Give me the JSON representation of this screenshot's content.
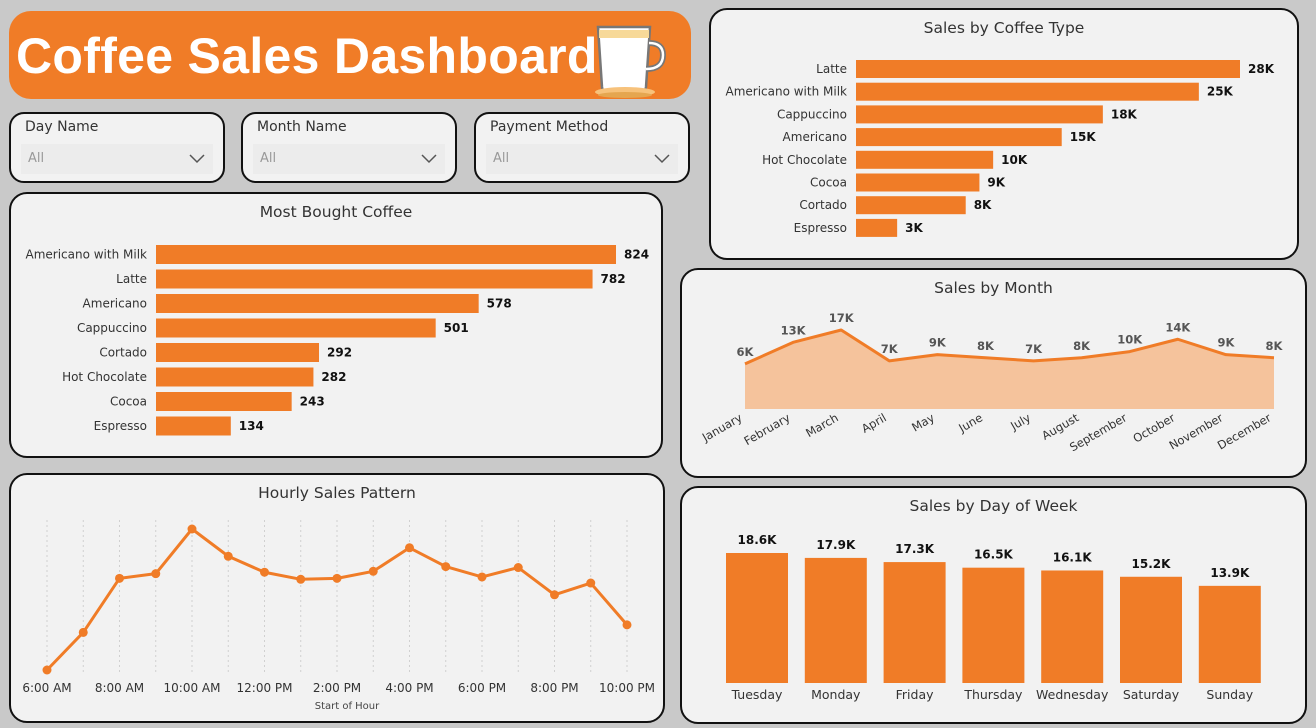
{
  "header": {
    "title": "Coffee Sales Dashboard",
    "accent_color": "#f07c27",
    "icon": "coffee-cup-icon"
  },
  "slicers": [
    {
      "label": "Day Name",
      "value": "All"
    },
    {
      "label": "Month Name",
      "value": "All"
    },
    {
      "label": "Payment Method",
      "value": "All"
    }
  ],
  "chart_data": [
    {
      "id": "most-bought",
      "type": "bar",
      "orientation": "horizontal",
      "title": "Most Bought Coffee",
      "categories": [
        "Americano with Milk",
        "Latte",
        "Americano",
        "Cappuccino",
        "Cortado",
        "Hot Chocolate",
        "Cocoa",
        "Espresso"
      ],
      "values": [
        824,
        782,
        578,
        501,
        292,
        282,
        243,
        134
      ],
      "data_labels": [
        "824",
        "782",
        "578",
        "501",
        "292",
        "282",
        "243",
        "134"
      ],
      "color": "#f07c27"
    },
    {
      "id": "sales-by-type",
      "type": "bar",
      "orientation": "horizontal",
      "title": "Sales by Coffee Type",
      "categories": [
        "Latte",
        "Americano with Milk",
        "Cappuccino",
        "Americano",
        "Hot Chocolate",
        "Cocoa",
        "Cortado",
        "Espresso"
      ],
      "values": [
        28,
        25,
        18,
        15,
        10,
        9,
        8,
        3
      ],
      "unit": "K",
      "data_labels": [
        "28K",
        "25K",
        "18K",
        "15K",
        "10K",
        "9K",
        "8K",
        "3K"
      ],
      "color": "#f07c27"
    },
    {
      "id": "sales-by-month",
      "type": "area",
      "title": "Sales by Month",
      "categories": [
        "January",
        "February",
        "March",
        "April",
        "May",
        "June",
        "July",
        "August",
        "September",
        "October",
        "November",
        "December"
      ],
      "values": [
        6,
        13,
        17,
        7,
        9,
        8,
        7,
        8,
        10,
        14,
        9,
        8
      ],
      "unit": "K",
      "data_labels": [
        "6K",
        "13K",
        "17K",
        "7K",
        "9K",
        "8K",
        "7K",
        "8K",
        "10K",
        "14K",
        "9K",
        "8K"
      ],
      "line_color": "#f07c27",
      "fill_color": "#f5c39c"
    },
    {
      "id": "hourly-sales",
      "type": "line",
      "title": "Hourly Sales Pattern",
      "xlabel": "Start of Hour",
      "x": [
        6,
        7,
        8,
        9,
        10,
        11,
        12,
        13,
        14,
        15,
        16,
        17,
        18,
        19,
        20,
        21,
        22
      ],
      "values": [
        80,
        160,
        275,
        285,
        380,
        322,
        288,
        273,
        275,
        290,
        340,
        300,
        278,
        298,
        240,
        265,
        176
      ],
      "tick_labels": [
        "6:00 AM",
        "8:00 AM",
        "10:00 AM",
        "12:00 PM",
        "2:00 PM",
        "4:00 PM",
        "6:00 PM",
        "8:00 PM",
        "10:00 PM"
      ],
      "grid": "vertical dotted",
      "color": "#f07c27"
    },
    {
      "id": "sales-by-day",
      "type": "bar",
      "orientation": "vertical",
      "title": "Sales by Day of Week",
      "categories": [
        "Tuesday",
        "Monday",
        "Friday",
        "Thursday",
        "Wednesday",
        "Saturday",
        "Sunday"
      ],
      "values": [
        18.6,
        17.9,
        17.3,
        16.5,
        16.1,
        15.2,
        13.9
      ],
      "unit": "K",
      "data_labels": [
        "18.6K",
        "17.9K",
        "17.3K",
        "16.5K",
        "16.1K",
        "15.2K",
        "13.9K"
      ],
      "color": "#f07c27"
    }
  ]
}
